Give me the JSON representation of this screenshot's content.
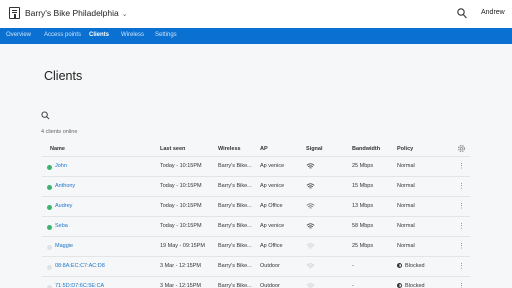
{
  "header": {
    "site_name": "Barry's Bike Philadelphia",
    "user": "Andrew"
  },
  "nav": {
    "items": [
      {
        "label": "Overview",
        "active": false
      },
      {
        "label": "Access points",
        "active": false
      },
      {
        "label": "Clients",
        "active": true
      },
      {
        "label": "Wireless",
        "active": false
      },
      {
        "label": "Settings",
        "active": false
      }
    ]
  },
  "main": {
    "title": "Clients",
    "count_text": "4 clients online",
    "columns": [
      "Name",
      "Last seen",
      "Wireless",
      "AP",
      "Signal",
      "Bandwidth",
      "Policy"
    ],
    "rows": [
      {
        "name": "John",
        "online": true,
        "last_seen": "Today - 10:15PM",
        "wireless": "Barry's Bike...",
        "ap": "Ap venice",
        "signal": "strong",
        "bandwidth": "25 Mbps",
        "policy": "Normal",
        "blocked": false
      },
      {
        "name": "Anthony",
        "online": true,
        "last_seen": "Today - 10:15PM",
        "wireless": "Barry's Bike...",
        "ap": "Ap venice",
        "signal": "strong",
        "bandwidth": "15 Mbps",
        "policy": "Normal",
        "blocked": false
      },
      {
        "name": "Audrey",
        "online": true,
        "last_seen": "Today - 10:15PM",
        "wireless": "Barry's Bike...",
        "ap": "Ap Office",
        "signal": "medium",
        "bandwidth": "13 Mbps",
        "policy": "Normal",
        "blocked": false
      },
      {
        "name": "Seba",
        "online": true,
        "last_seen": "Today - 10:15PM",
        "wireless": "Barry's Bike...",
        "ap": "Ap venice",
        "signal": "strong",
        "bandwidth": "58 Mbps",
        "policy": "Normal",
        "blocked": false
      },
      {
        "name": "Maggie",
        "online": false,
        "last_seen": "19 May - 09:15PM",
        "wireless": "Barry's Bike...",
        "ap": "Ap Office",
        "signal": "offline",
        "bandwidth": "25 Mbps",
        "policy": "Normal",
        "blocked": false
      },
      {
        "name": "08:8A:EC:C7:AC:D8",
        "online": false,
        "last_seen": "3 Mar - 12:15PM",
        "wireless": "Barry's Bike...",
        "ap": "Outdoor",
        "signal": "offline",
        "bandwidth": "-",
        "policy": "Blocked",
        "blocked": true
      },
      {
        "name": "71:5D:D7:6C:5E:CA",
        "online": false,
        "last_seen": "3 Mar - 12:15PM",
        "wireless": "Barry's Bike...",
        "ap": "Outdoor",
        "signal": "offline",
        "bandwidth": "-",
        "policy": "Blocked",
        "blocked": true
      }
    ]
  },
  "icons": {
    "site": "building-icon",
    "search": "search-icon",
    "settings": "gear-icon",
    "signal": "wifi-icon",
    "row_menu": "more-vertical-icon",
    "blocked": "blocked-icon"
  },
  "colors": {
    "nav_bg": "#0a71d2",
    "link": "#1b74c8",
    "online": "#3cb371",
    "offline": "#dfe2e5"
  }
}
